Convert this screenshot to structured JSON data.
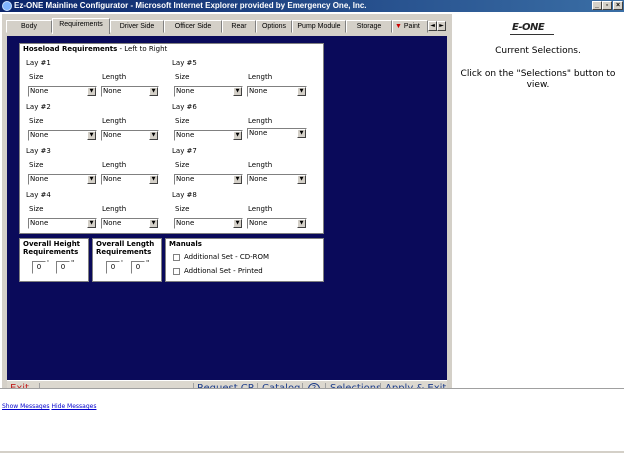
{
  "window": {
    "title": "Ez-ONE Mainline Configurator - Microsoft Internet Explorer provided by Emergency One, Inc.",
    "minimize": "_",
    "restore": "▫",
    "close": "×"
  },
  "tabs": [
    "Body",
    "Requirements",
    "Driver Side",
    "Officer Side",
    "Rear",
    "Options",
    "Pump Module",
    "Storage",
    "Paint"
  ],
  "active_tab": "Requirements",
  "tab_scroll": {
    "left": "◄",
    "right": "►"
  },
  "hoseload": {
    "title": "Hoseload Requirements",
    "subtitle": " - Left to Right",
    "size_label": "Size",
    "length_label": "Length",
    "lays": [
      {
        "name": "Lay #1",
        "size": "None",
        "length": "None"
      },
      {
        "name": "Lay #2",
        "size": "None",
        "length": "None"
      },
      {
        "name": "Lay #3",
        "size": "None",
        "length": "None"
      },
      {
        "name": "Lay #4",
        "size": "None",
        "length": "None"
      },
      {
        "name": "Lay #5",
        "size": "None",
        "length": "None"
      },
      {
        "name": "Lay #6",
        "size": "None",
        "length": "None"
      },
      {
        "name": "Lay #7",
        "size": "None",
        "length": "None"
      },
      {
        "name": "Lay #8",
        "size": "None",
        "length": "None"
      }
    ]
  },
  "height": {
    "title1": "Overall Height",
    "title2": "Requirements",
    "feet": "0",
    "inches": "0",
    "feet_mark": "'",
    "inch_mark": "\""
  },
  "length": {
    "title1": "Overall Length",
    "title2": "Requirements",
    "feet": "0",
    "inches": "0",
    "feet_mark": "'",
    "inch_mark": "\""
  },
  "manuals": {
    "title": "Manuals",
    "items": [
      "Additional Set - CD-ROM",
      "Addtional Set - Printed"
    ]
  },
  "toolbar": {
    "exit": "Exit",
    "request_cr": "Request CR",
    "catalog": "Catalog",
    "help": "?",
    "selections": "Selections",
    "apply_exit": "Apply & Exit"
  },
  "right": {
    "logo": "E-ONE",
    "current": "Current Selections.",
    "instructions": "Click on the \"Selections\" button to view."
  },
  "messages": {
    "show": "Show Messages",
    "hide": "Hide Messages"
  }
}
